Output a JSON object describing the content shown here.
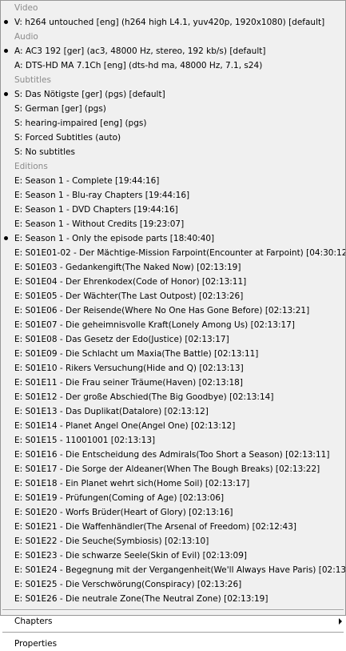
{
  "menu": {
    "sections": [
      {
        "header": "Video",
        "items": [
          {
            "label": "V: h264 untouched [eng] (h264 high L4.1, yuv420p, 1920x1080) [default]",
            "selected": true
          }
        ]
      },
      {
        "header": "Audio",
        "items": [
          {
            "label": "A: AC3 192 [ger] (ac3, 48000 Hz, stereo, 192 kb/s) [default]",
            "selected": true
          },
          {
            "label": "A: DTS-HD MA 7.1Ch [eng] (dts-hd ma, 48000 Hz, 7.1, s24)",
            "selected": false
          }
        ]
      },
      {
        "header": "Subtitles",
        "items": [
          {
            "label": "S: Das Nötigste [ger] (pgs) [default]",
            "selected": true
          },
          {
            "label": "S: German [ger] (pgs)",
            "selected": false
          },
          {
            "label": "S: hearing-impaired [eng] (pgs)",
            "selected": false
          },
          {
            "label": "S: Forced Subtitles (auto)",
            "selected": false
          },
          {
            "label": "S: No subtitles",
            "selected": false
          }
        ]
      },
      {
        "header": "Editions",
        "items": [
          {
            "label": "E: Season 1 - Complete [19:44:16]",
            "selected": false
          },
          {
            "label": "E: Season 1 - Blu-ray Chapters [19:44:16]",
            "selected": false
          },
          {
            "label": "E: Season 1 - DVD Chapters [19:44:16]",
            "selected": false
          },
          {
            "label": "E: Season 1 - Without Credits [19:23:07]",
            "selected": false
          },
          {
            "label": "E: Season 1 - Only the episode parts [18:40:40]",
            "selected": true
          },
          {
            "label": "E: S01E01-02 - Der Mächtige-Mission Farpoint(Encounter at Farpoint) [04:30:12]",
            "selected": false
          },
          {
            "label": "E: S01E03 - Gedankengift(The Naked Now) [02:13:19]",
            "selected": false
          },
          {
            "label": "E: S01E04 - Der Ehrenkodex(Code of Honor) [02:13:11]",
            "selected": false
          },
          {
            "label": "E: S01E05 - Der Wächter(The Last Outpost) [02:13:26]",
            "selected": false
          },
          {
            "label": "E: S01E06 - Der Reisende(Where No One Has Gone Before) [02:13:21]",
            "selected": false
          },
          {
            "label": "E: S01E07 - Die geheimnisvolle Kraft(Lonely Among Us) [02:13:17]",
            "selected": false
          },
          {
            "label": "E: S01E08 - Das Gesetz der Edo(Justice) [02:13:17]",
            "selected": false
          },
          {
            "label": "E: S01E09 - Die Schlacht um Maxia(The Battle) [02:13:11]",
            "selected": false
          },
          {
            "label": "E: S01E10 - Rikers Versuchung(Hide and Q) [02:13:13]",
            "selected": false
          },
          {
            "label": "E: S01E11 - Die Frau seiner Träume(Haven) [02:13:18]",
            "selected": false
          },
          {
            "label": "E: S01E12 - Der große Abschied(The Big Goodbye) [02:13:14]",
            "selected": false
          },
          {
            "label": "E: S01E13 - Das Duplikat(Datalore) [02:13:12]",
            "selected": false
          },
          {
            "label": "E: S01E14 - Planet Angel One(Angel One) [02:13:12]",
            "selected": false
          },
          {
            "label": "E: S01E15 - 11001001 [02:13:13]",
            "selected": false
          },
          {
            "label": "E: S01E16 - Die Entscheidung des Admirals(Too Short a Season) [02:13:11]",
            "selected": false
          },
          {
            "label": "E: S01E17 - Die Sorge der Aldeaner(When The Bough Breaks) [02:13:22]",
            "selected": false
          },
          {
            "label": "E: S01E18 - Ein Planet wehrt sich(Home Soil) [02:13:17]",
            "selected": false
          },
          {
            "label": "E: S01E19 - Prüfungen(Coming of Age) [02:13:06]",
            "selected": false
          },
          {
            "label": "E: S01E20 - Worfs Brüder(Heart of Glory) [02:13:16]",
            "selected": false
          },
          {
            "label": "E: S01E21 - Die Waffenhändler(The Arsenal of Freedom) [02:12:43]",
            "selected": false
          },
          {
            "label": "E: S01E22 - Die Seuche(Symbiosis) [02:13:10]",
            "selected": false
          },
          {
            "label": "E: S01E23 - Die schwarze Seele(Skin of Evil) [02:13:09]",
            "selected": false
          },
          {
            "label": "E: S01E24 - Begegnung mit der Vergangenheit(We'll Always Have Paris) [02:13:11]",
            "selected": false
          },
          {
            "label": "E: S01E25 - Die Verschwörung(Conspiracy) [02:13:26]",
            "selected": false
          },
          {
            "label": "E: S01E26 - Die neutrale Zone(The Neutral Zone) [02:13:19]",
            "selected": false
          }
        ]
      }
    ],
    "chapters_label": "Chapters",
    "properties_label": "Properties"
  }
}
